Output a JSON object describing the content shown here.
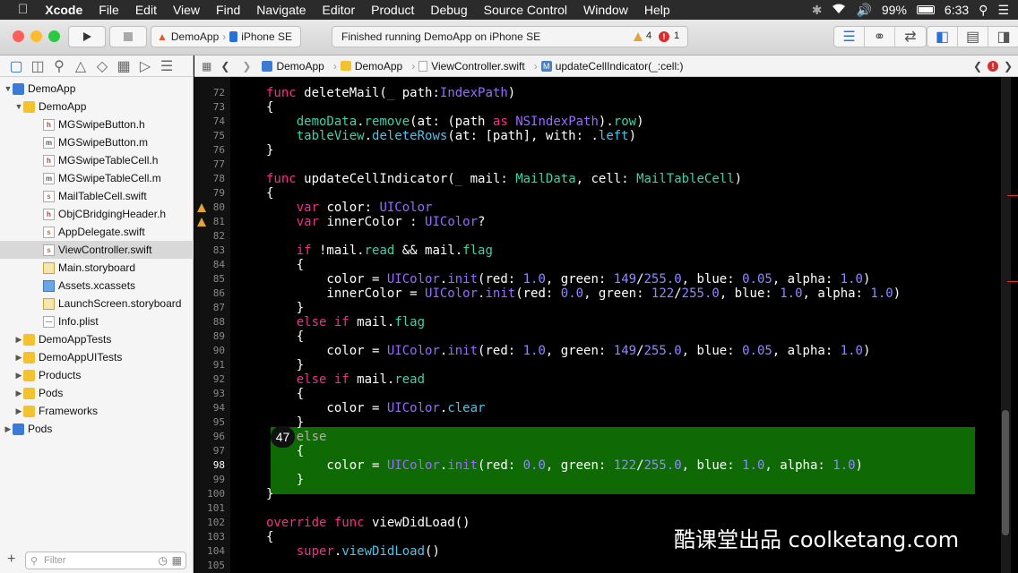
{
  "menubar": {
    "apple": "",
    "items": [
      "Xcode",
      "File",
      "Edit",
      "View",
      "Find",
      "Navigate",
      "Editor",
      "Product",
      "Debug",
      "Source Control",
      "Window",
      "Help"
    ],
    "battery": "99%",
    "time": "6:33"
  },
  "toolbar": {
    "scheme": "DemoApp",
    "device": "iPhone SE",
    "activity": "Finished running DemoApp on iPhone SE",
    "warnings": "4",
    "errors": "1"
  },
  "navigator": {
    "filter_placeholder": "Filter",
    "items": [
      {
        "label": "DemoApp",
        "type": "project"
      },
      {
        "label": "DemoApp",
        "type": "folder"
      },
      {
        "label": "MGSwipeButton.h",
        "type": "h"
      },
      {
        "label": "MGSwipeButton.m",
        "type": "m"
      },
      {
        "label": "MGSwipeTableCell.h",
        "type": "h"
      },
      {
        "label": "MGSwipeTableCell.m",
        "type": "m"
      },
      {
        "label": "MailTableCell.swift",
        "type": "swift"
      },
      {
        "label": "ObjCBridgingHeader.h",
        "type": "h"
      },
      {
        "label": "AppDelegate.swift",
        "type": "swift"
      },
      {
        "label": "ViewController.swift",
        "type": "swift"
      },
      {
        "label": "Main.storyboard",
        "type": "storyboard"
      },
      {
        "label": "Assets.xcassets",
        "type": "assets"
      },
      {
        "label": "LaunchScreen.storyboard",
        "type": "storyboard"
      },
      {
        "label": "Info.plist",
        "type": "plist"
      },
      {
        "label": "DemoAppTests",
        "type": "folder"
      },
      {
        "label": "DemoAppUITests",
        "type": "folder"
      },
      {
        "label": "Products",
        "type": "folder"
      },
      {
        "label": "Pods",
        "type": "folder"
      },
      {
        "label": "Frameworks",
        "type": "folder"
      },
      {
        "label": "Pods",
        "type": "project"
      }
    ]
  },
  "jumpbar": {
    "crumbs": [
      "DemoApp",
      "DemoApp",
      "ViewController.swift",
      "updateCellIndicator(_:cell:)"
    ]
  },
  "editor": {
    "line_numbers": [
      "72",
      "73",
      "74",
      "75",
      "76",
      "77",
      "78",
      "79",
      "80",
      "81",
      "82",
      "83",
      "84",
      "85",
      "86",
      "87",
      "88",
      "89",
      "90",
      "91",
      "92",
      "93",
      "94",
      "95",
      "96",
      "97",
      "98",
      "99",
      "100",
      "101",
      "102",
      "103",
      "104",
      "105"
    ],
    "breakpoint_badge": "47"
  },
  "watermark": "酷课堂出品 coolketang.com",
  "colors": {
    "highlight": "#0f6a06",
    "keyword": "#f92c8c",
    "type": "#9b6bff",
    "number": "#8f89ff"
  }
}
